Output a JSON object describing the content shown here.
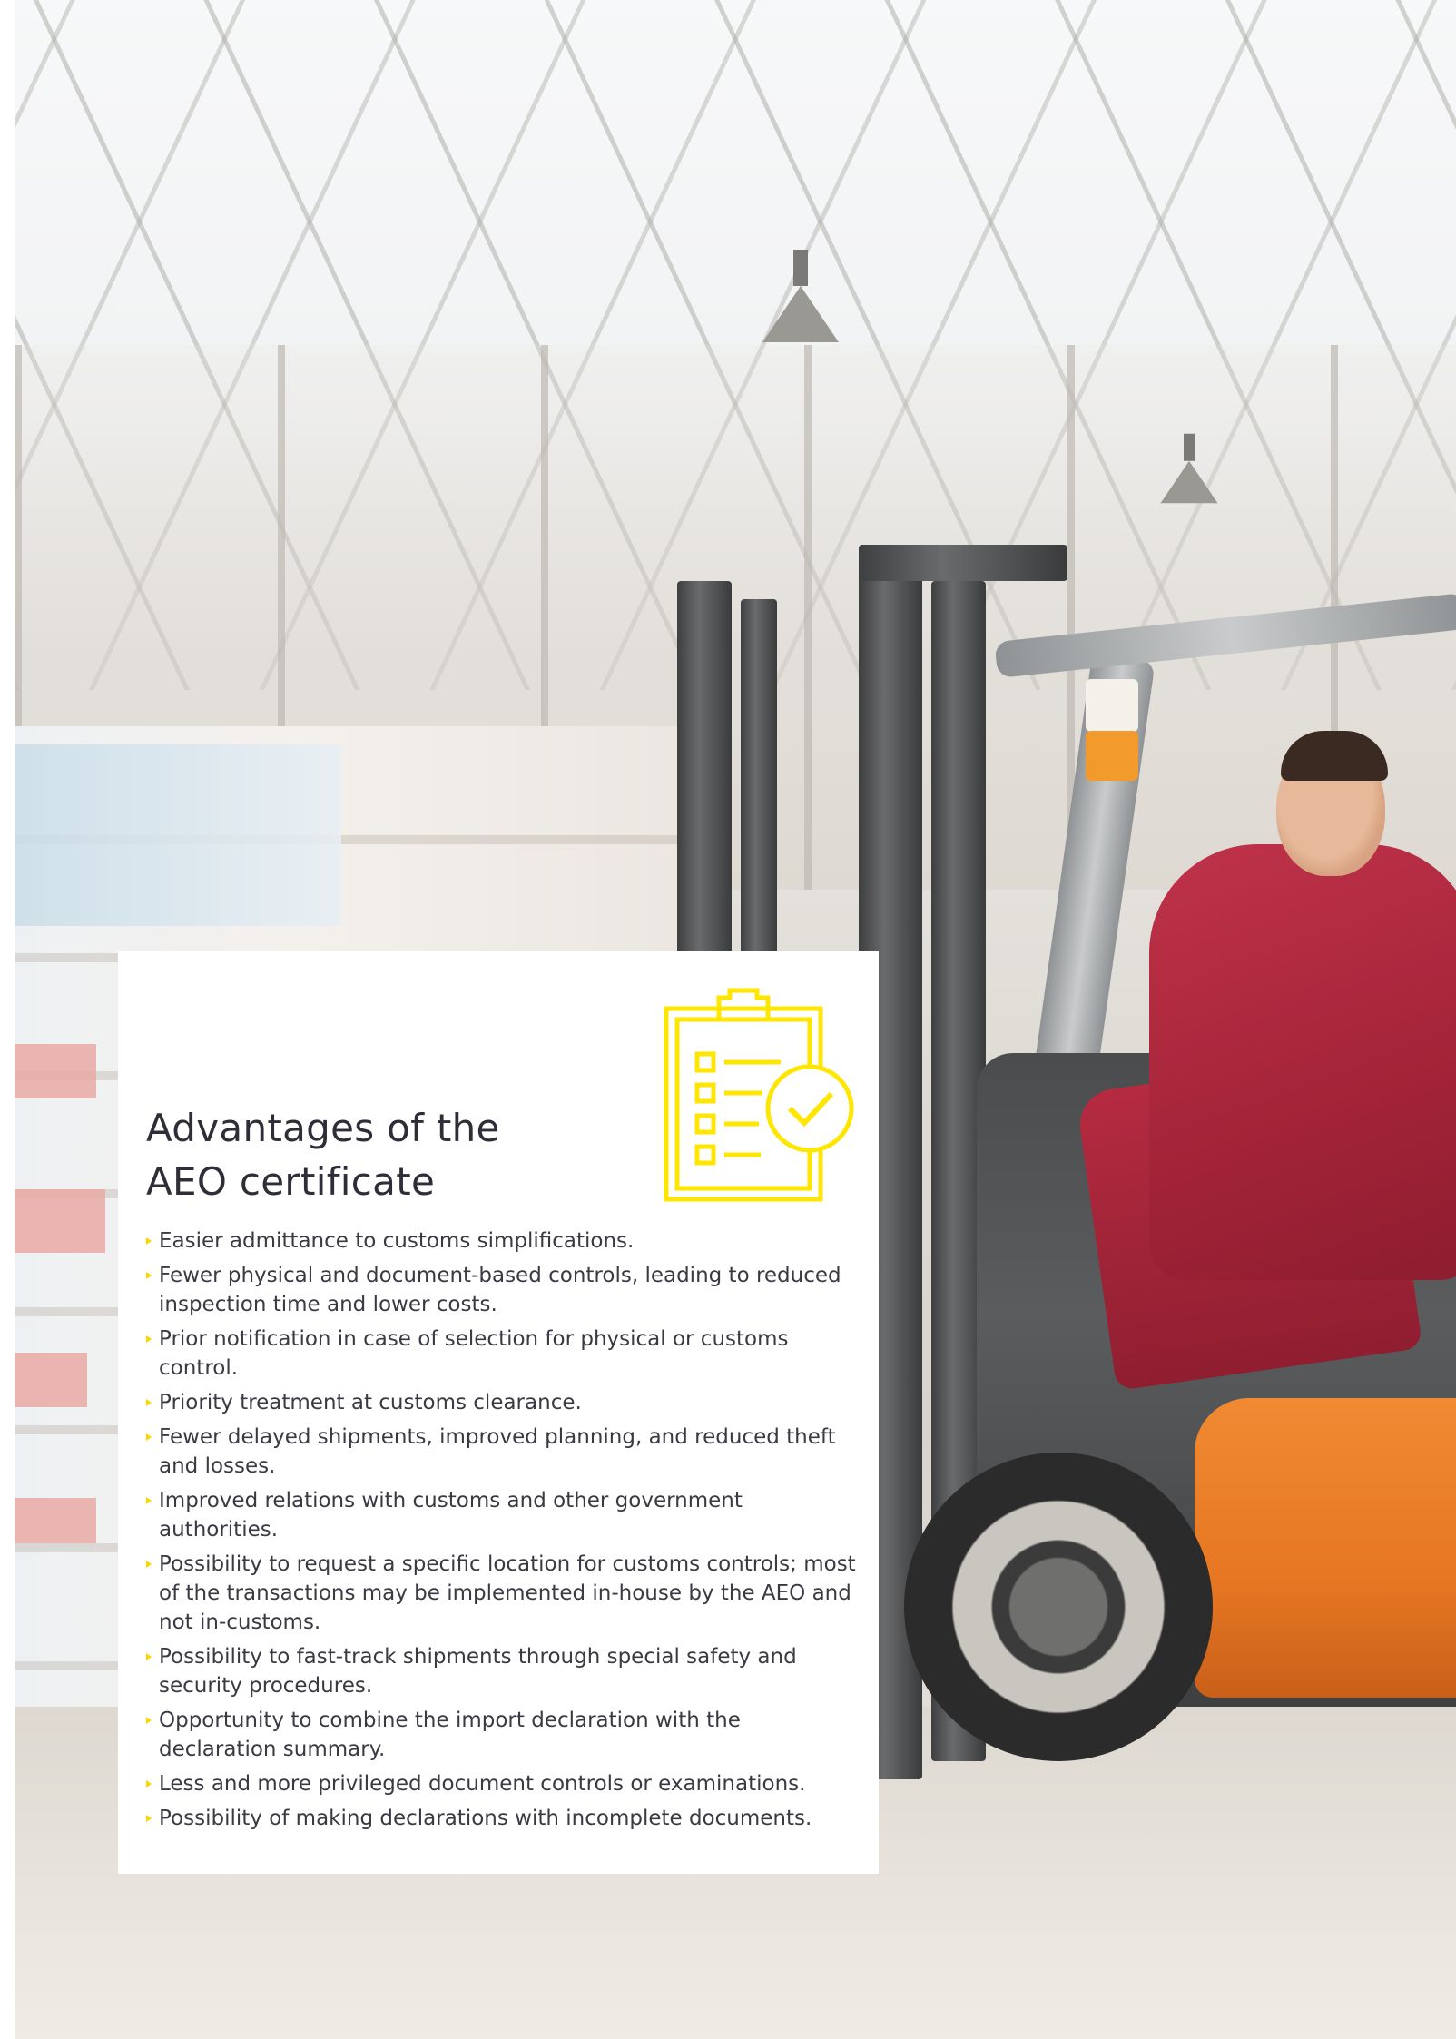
{
  "card": {
    "title_line_1": "Advantages of the",
    "title_line_2": "AEO certificate",
    "icon": "clipboard-checklist-check-icon",
    "accent_color": "#ffe600",
    "items": [
      {
        "text": "Easier admittance to customs simplifications."
      },
      {
        "text": "Fewer physical and document-based controls, leading to reduced inspection time and lower costs."
      },
      {
        "text": "Prior notification in case of selection for physical or customs control."
      },
      {
        "text": "Priority treatment at customs clearance."
      },
      {
        "text": "Fewer delayed shipments, improved planning, and reduced theft and losses."
      },
      {
        "text": "Improved relations with customs and other government authorities."
      },
      {
        "text": "Possibility to request a specific location for customs controls; most of the transactions may be implemented in-house by the AEO and not in-customs."
      },
      {
        "text": "Possibility to fast-track shipments through special safety and security procedures."
      },
      {
        "text": "Opportunity to combine the import declaration with the declaration summary."
      },
      {
        "text": "Less and more privileged document controls or examinations."
      },
      {
        "text": "Possibility of making declarations with incomplete documents."
      }
    ]
  }
}
